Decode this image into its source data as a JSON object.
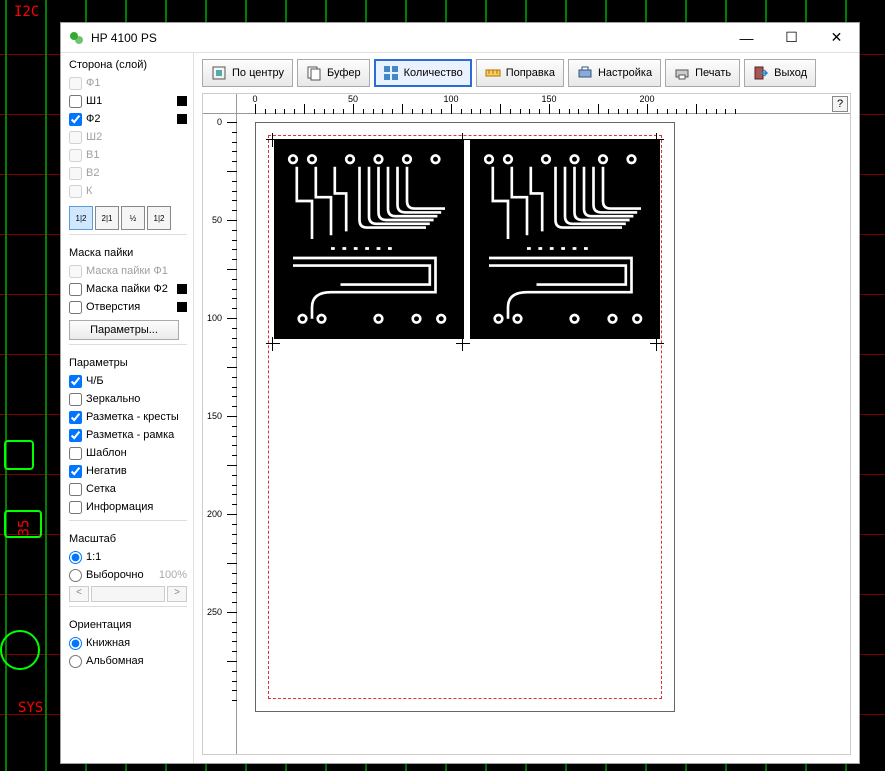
{
  "bg_labels": {
    "i2c": "I2C",
    "sys": "SYS",
    "num": "35"
  },
  "window": {
    "title": "HP 4100 PS",
    "btn_min": "—",
    "btn_max": "☐",
    "btn_close": "✕"
  },
  "toolbar": {
    "center": "По центру",
    "buffer": "Буфер",
    "quantity": "Количество",
    "correction": "Поправка",
    "settings": "Настройка",
    "print": "Печать",
    "exit": "Выход"
  },
  "help": "?",
  "sidebar": {
    "layers_hdr": "Сторона (слой)",
    "layers": [
      {
        "label": "Ф1",
        "checked": false,
        "disabled": true,
        "swatch": false
      },
      {
        "label": "Ш1",
        "checked": false,
        "disabled": false,
        "swatch": true
      },
      {
        "label": "Ф2",
        "checked": true,
        "disabled": false,
        "swatch": true
      },
      {
        "label": "Ш2",
        "checked": false,
        "disabled": true,
        "swatch": false
      },
      {
        "label": "В1",
        "checked": false,
        "disabled": true,
        "swatch": false
      },
      {
        "label": "В2",
        "checked": false,
        "disabled": true,
        "swatch": false
      },
      {
        "label": "К",
        "checked": false,
        "disabled": true,
        "swatch": false
      }
    ],
    "layerbtn_labels": [
      "1|2",
      "2|1",
      "½",
      "1|2"
    ],
    "mask_hdr": "Маска пайки",
    "mask": [
      {
        "label": "Маска пайки Ф1",
        "checked": false,
        "disabled": true,
        "swatch": false
      },
      {
        "label": "Маска пайки Ф2",
        "checked": false,
        "disabled": false,
        "swatch": true
      },
      {
        "label": "Отверстия",
        "checked": false,
        "disabled": false,
        "swatch": true
      }
    ],
    "params_btn": "Параметры...",
    "params_hdr": "Параметры",
    "params": [
      {
        "label": "Ч/Б",
        "checked": true
      },
      {
        "label": "Зеркально",
        "checked": false
      },
      {
        "label": "Разметка - кресты",
        "checked": true
      },
      {
        "label": "Разметка - рамка",
        "checked": true
      },
      {
        "label": "Шаблон",
        "checked": false
      },
      {
        "label": "Негатив",
        "checked": true
      },
      {
        "label": "Сетка",
        "checked": false
      },
      {
        "label": "Информация",
        "checked": false
      }
    ],
    "scale_hdr": "Масштаб",
    "scale_11": "1:1",
    "scale_sel": "Выборочно",
    "scale_pct": "100%",
    "orient_hdr": "Ориентация",
    "orient_portrait": "Книжная",
    "orient_landscape": "Альбомная"
  },
  "ruler": {
    "h": [
      "0",
      "50",
      "100",
      "150",
      "200"
    ],
    "v": [
      "0",
      "50",
      "100",
      "150",
      "200",
      "250"
    ]
  }
}
